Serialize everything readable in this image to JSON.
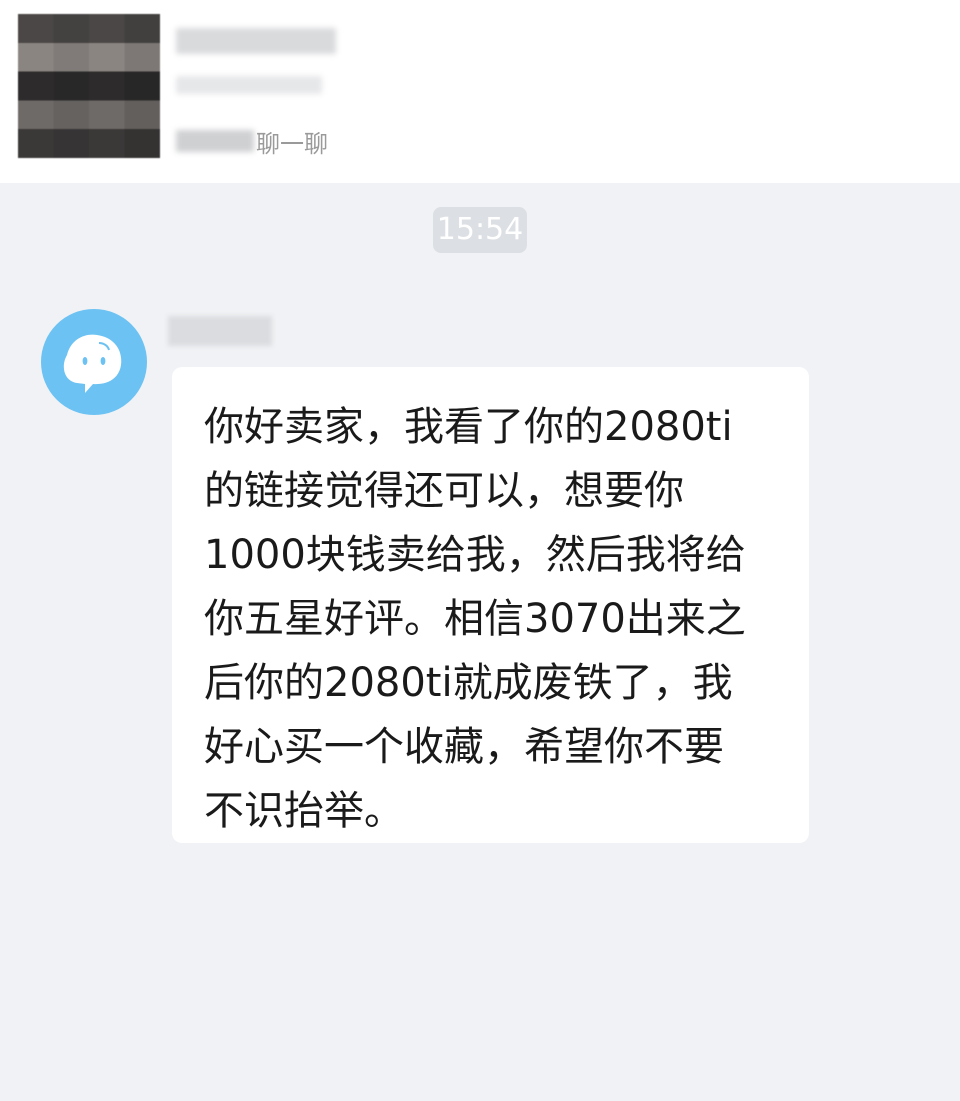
{
  "header": {
    "hint_text": "聊一聊"
  },
  "timestamp": "15:54",
  "message": {
    "lines": [
      "你好卖家，我看了你的2080ti",
      "的链接觉得还可以，想要你",
      "1000块钱卖给我，然后我将给",
      "你五星好评。相信3070出来之",
      "后你的2080ti就成废铁了，我",
      "好心买一个收藏，希望你不要",
      "不识抬举。"
    ]
  },
  "colors": {
    "background": "#f0f2f5",
    "header_background": "#ffffff",
    "avatar_blue": "#6cc2f2",
    "bubble": "#ffffff",
    "time_pill": "#dcdfe3"
  },
  "icons": {
    "sender_avatar": "cartoon-face-icon"
  }
}
